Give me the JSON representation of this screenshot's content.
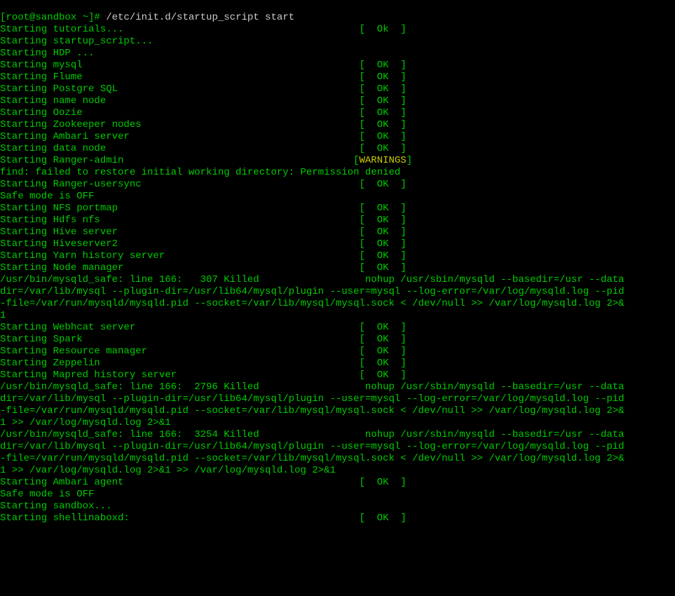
{
  "prompt": "[root@sandbox ~]# ",
  "command": "/etc/init.d/startup_script start",
  "l": {
    "0": {
      "a": "Starting tutorials...                                        ",
      "b": "[  ",
      "c": "Ok",
      "d": "  ]"
    },
    "1": {
      "a": "Starting startup_script..."
    },
    "2": {
      "a": "Starting HDP ..."
    },
    "3": {
      "a": "Starting mysql                                               ",
      "b": "[  ",
      "c": "OK",
      "d": "  ]"
    },
    "4": {
      "a": "Starting Flume                                               ",
      "b": "[  ",
      "c": "OK",
      "d": "  ]"
    },
    "5": {
      "a": "Starting Postgre SQL                                         ",
      "b": "[  ",
      "c": "OK",
      "d": "  ]"
    },
    "6": {
      "a": "Starting name node                                           ",
      "b": "[  ",
      "c": "OK",
      "d": "  ]"
    },
    "7": {
      "a": "Starting Oozie                                               ",
      "b": "[  ",
      "c": "OK",
      "d": "  ]"
    },
    "8": {
      "a": "Starting Zookeeper nodes                                     ",
      "b": "[  ",
      "c": "OK",
      "d": "  ]"
    },
    "9": {
      "a": "Starting Ambari server                                       ",
      "b": "[  ",
      "c": "OK",
      "d": "  ]"
    },
    "10": {
      "a": "Starting data node                                           ",
      "b": "[  ",
      "c": "OK",
      "d": "  ]"
    },
    "11": {
      "a": "Starting Ranger-admin                                       ",
      "b": "[",
      "c": "WARNINGS",
      "d": "]"
    },
    "12": {
      "a": "find: failed to restore initial working directory: Permission denied"
    },
    "13": {
      "a": "Starting Ranger-usersync                                     ",
      "b": "[  ",
      "c": "OK",
      "d": "  ]"
    },
    "14": {
      "a": "Safe mode is OFF"
    },
    "15": {
      "a": "Starting NFS portmap                                         ",
      "b": "[  ",
      "c": "OK",
      "d": "  ]"
    },
    "16": {
      "a": "Starting Hdfs nfs                                            ",
      "b": "[  ",
      "c": "OK",
      "d": "  ]"
    },
    "17": {
      "a": "Starting Hive server                                         ",
      "b": "[  ",
      "c": "OK",
      "d": "  ]"
    },
    "18": {
      "a": "Starting Hiveserver2                                         ",
      "b": "[  ",
      "c": "OK",
      "d": "  ]"
    },
    "19": {
      "a": "Starting Yarn history server                                 ",
      "b": "[  ",
      "c": "OK",
      "d": "  ]"
    },
    "20": {
      "a": "Starting Node manager                                        ",
      "b": "[  ",
      "c": "OK",
      "d": "  ]"
    },
    "21": {
      "a": "/usr/bin/mysqld_safe: line 166:   307 Killed                  nohup /usr/sbin/mysqld --basedir=/usr --data"
    },
    "22": {
      "a": "dir=/var/lib/mysql --plugin-dir=/usr/lib64/mysql/plugin --user=mysql --log-error=/var/log/mysqld.log --pid"
    },
    "23": {
      "a": "-file=/var/run/mysqld/mysqld.pid --socket=/var/lib/mysql/mysql.sock < /dev/null >> /var/log/mysqld.log 2>&"
    },
    "24": {
      "a": "1"
    },
    "25": {
      "a": "Starting Webhcat server                                      ",
      "b": "[  ",
      "c": "OK",
      "d": "  ]"
    },
    "26": {
      "a": "Starting Spark                                               ",
      "b": "[  ",
      "c": "OK",
      "d": "  ]"
    },
    "27": {
      "a": "Starting Resource manager                                    ",
      "b": "[  ",
      "c": "OK",
      "d": "  ]"
    },
    "28": {
      "a": "Starting Zeppelin                                            ",
      "b": "[  ",
      "c": "OK",
      "d": "  ]"
    },
    "29": {
      "a": "Starting Mapred history server                               ",
      "b": "[  ",
      "c": "OK",
      "d": "  ]"
    },
    "30": {
      "a": "/usr/bin/mysqld_safe: line 166:  2796 Killed                  nohup /usr/sbin/mysqld --basedir=/usr --data"
    },
    "31": {
      "a": "dir=/var/lib/mysql --plugin-dir=/usr/lib64/mysql/plugin --user=mysql --log-error=/var/log/mysqld.log --pid"
    },
    "32": {
      "a": "-file=/var/run/mysqld/mysqld.pid --socket=/var/lib/mysql/mysql.sock < /dev/null >> /var/log/mysqld.log 2>&"
    },
    "33": {
      "a": "1 >> /var/log/mysqld.log 2>&1"
    },
    "34": {
      "a": "/usr/bin/mysqld_safe: line 166:  3254 Killed                  nohup /usr/sbin/mysqld --basedir=/usr --data"
    },
    "35": {
      "a": "dir=/var/lib/mysql --plugin-dir=/usr/lib64/mysql/plugin --user=mysql --log-error=/var/log/mysqld.log --pid"
    },
    "36": {
      "a": "-file=/var/run/mysqld/mysqld.pid --socket=/var/lib/mysql/mysql.sock < /dev/null >> /var/log/mysqld.log 2>&"
    },
    "37": {
      "a": "1 >> /var/log/mysqld.log 2>&1 >> /var/log/mysqld.log 2>&1"
    },
    "38": {
      "a": "Starting Ambari agent                                        ",
      "b": "[  ",
      "c": "OK",
      "d": "  ]"
    },
    "39": {
      "a": "Safe mode is OFF"
    },
    "40": {
      "a": "Starting sandbox..."
    },
    "41": {
      "a": "Starting shellinaboxd:                                       ",
      "b": "[  ",
      "c": "OK",
      "d": "  ]"
    }
  }
}
